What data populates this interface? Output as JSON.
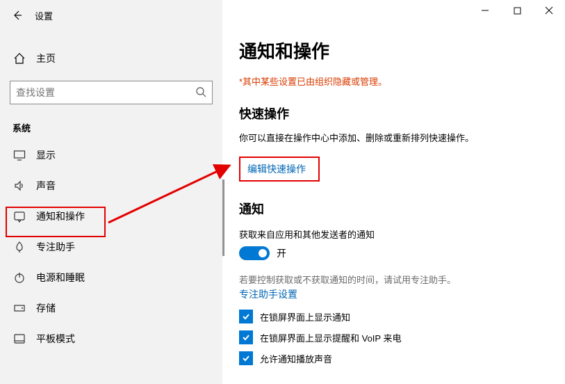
{
  "window": {
    "title": "设置"
  },
  "sidebar": {
    "home_label": "主页",
    "search_placeholder": "查找设置",
    "section_label": "系统",
    "items": [
      {
        "label": "显示",
        "icon": "display"
      },
      {
        "label": "声音",
        "icon": "sound"
      },
      {
        "label": "通知和操作",
        "icon": "notifications",
        "selected": true
      },
      {
        "label": "专注助手",
        "icon": "focus"
      },
      {
        "label": "电源和睡眠",
        "icon": "power"
      },
      {
        "label": "存储",
        "icon": "storage"
      },
      {
        "label": "平板模式",
        "icon": "tablet"
      }
    ]
  },
  "content": {
    "title": "通知和操作",
    "policy_note": "*其中某些设置已由组织隐藏或管理。",
    "quick_actions_title": "快速操作",
    "quick_actions_desc": "你可以直接在操作中心中添加、删除或重新排列快速操作。",
    "edit_link": "编辑快速操作",
    "notifications_title": "通知",
    "notif_toggle_desc": "获取来自应用和其他发送者的通知",
    "toggle_label": "开",
    "focus_desc1": "若要控制获取或不获取通知的时间，请试用专注助手。",
    "focus_link": "专注助手设置",
    "checkboxes": [
      "在锁屏界面上显示通知",
      "在锁屏界面上显示提醒和 VoIP 来电",
      "允许通知播放声音"
    ]
  }
}
